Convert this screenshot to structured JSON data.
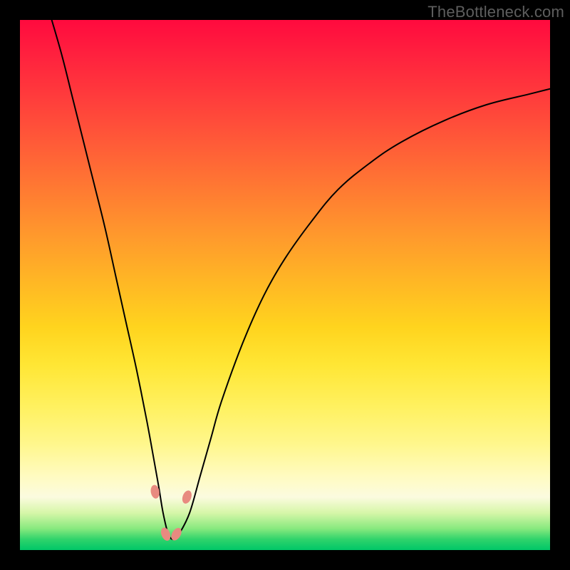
{
  "attribution": "TheBottleneck.com",
  "chart_data": {
    "type": "line",
    "title": "",
    "xlabel": "",
    "ylabel": "",
    "xlim": [
      0,
      100
    ],
    "ylim": [
      0,
      100
    ],
    "grid": false,
    "series": [
      {
        "name": "bottleneck-curve",
        "x": [
          6,
          8,
          10,
          12,
          14,
          16,
          18,
          20,
          22,
          24,
          26,
          27,
          28,
          29,
          30,
          32,
          34,
          36,
          38,
          42,
          46,
          50,
          55,
          60,
          66,
          72,
          80,
          88,
          96,
          100
        ],
        "y": [
          100,
          93,
          85,
          77,
          69,
          61,
          52,
          43,
          34,
          24,
          13,
          7,
          3,
          2,
          3,
          7,
          14,
          21,
          28,
          39,
          48,
          55,
          62,
          68,
          73,
          77,
          81,
          84,
          86,
          87
        ]
      }
    ],
    "gradient_stops": [
      {
        "pos": 0,
        "color": "#ff0a3e"
      },
      {
        "pos": 50,
        "color": "#ffb924"
      },
      {
        "pos": 86,
        "color": "#fffbc0"
      },
      {
        "pos": 100,
        "color": "#00c768"
      }
    ],
    "markers": [
      {
        "x": 25.5,
        "y": 11,
        "r": 6,
        "color": "#e88a80"
      },
      {
        "x": 27.5,
        "y": 3,
        "r": 6,
        "color": "#e88a80"
      },
      {
        "x": 29.5,
        "y": 3,
        "r": 6,
        "color": "#e88a80"
      },
      {
        "x": 31.5,
        "y": 10,
        "r": 6,
        "color": "#e88a80"
      }
    ]
  }
}
